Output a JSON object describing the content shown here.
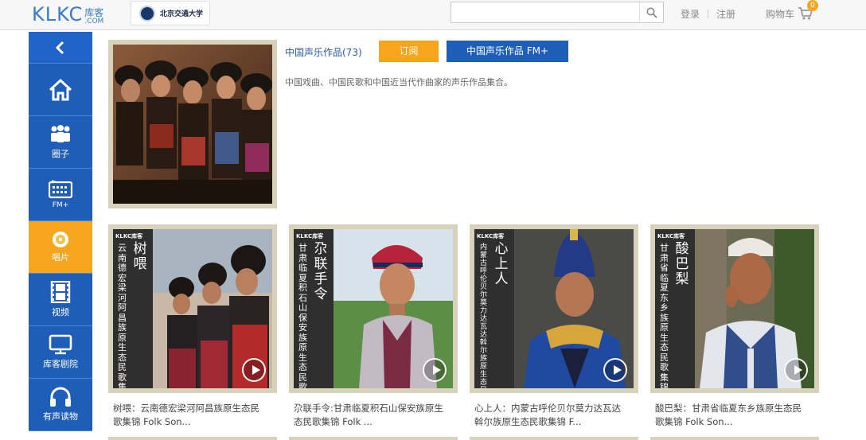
{
  "header": {
    "logo_text": "KLKC",
    "logo_cn": "库客",
    "logo_com": ".COM",
    "partner_name": "北京交通大学",
    "search": {
      "value": "",
      "placeholder": ""
    },
    "login": "登录",
    "register": "注册",
    "cart_label": "购物车",
    "cart_count": "0"
  },
  "sidebar": {
    "items": [
      {
        "label": "",
        "icon": "home-icon"
      },
      {
        "label": "圈子",
        "icon": "people-icon"
      },
      {
        "label": "FM+",
        "icon": "fm-radio-icon"
      },
      {
        "label": "唱片",
        "icon": "disc-icon",
        "active": true
      },
      {
        "label": "视频",
        "icon": "film-icon"
      },
      {
        "label": "库客剧院",
        "icon": "tv-icon"
      },
      {
        "label": "有声读物",
        "icon": "headphones-icon"
      }
    ]
  },
  "album": {
    "title": "中国声乐作品(73)",
    "subscribe": "订阅",
    "fm": "中国声乐作品 FM+",
    "description": "中国戏曲、中国民歌和中国近当代作曲家的声乐作品集合。"
  },
  "cards": [
    {
      "brand": "KLKC库客",
      "big": "树喂",
      "small": "云南德宏梁河阿昌族原生态民歌集锦",
      "caption_line1": "树喂：云南德宏梁河阿昌族原生态民",
      "caption_line2": "歌集锦 Folk Son..."
    },
    {
      "brand": "KLKC库客",
      "big": "尕联手令",
      "small": "甘肃临夏积石山保安族原生态民歌集锦",
      "caption_line1": "尕联手令:甘肃临夏积石山保安族原生",
      "caption_line2": "态民歌集锦 Folk ..."
    },
    {
      "brand": "KLKC库客",
      "big": "心上人",
      "small": "内蒙古呼伦贝尔莫力达瓦达斡尔族原生态民歌集锦",
      "caption_line1": "心上人：内蒙古呼伦贝尔莫力达瓦达",
      "caption_line2": "斡尔族原生态民歌集锦 F..."
    },
    {
      "brand": "KLKC库客",
      "big": "酸巴梨",
      "small": "甘肃省临夏东乡族原生态民歌集锦",
      "caption_line1": "酸巴梨：甘肃省临夏东乡族原生态民",
      "caption_line2": "歌集锦 Folk Son..."
    }
  ]
}
